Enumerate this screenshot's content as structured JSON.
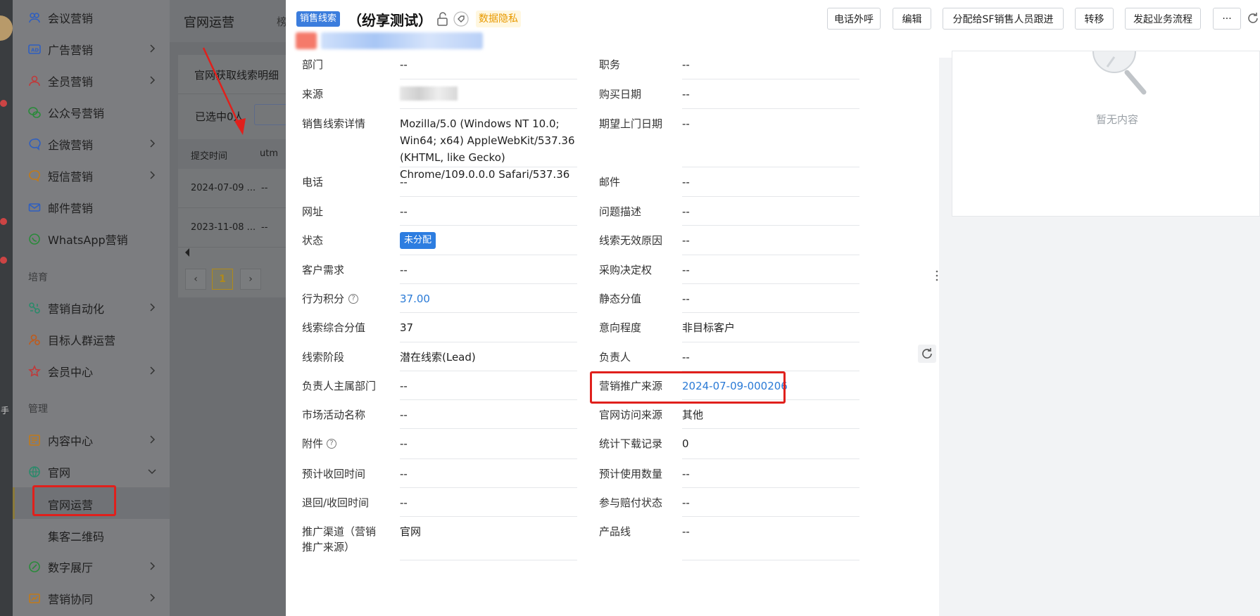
{
  "sidebar": {
    "items": [
      {
        "label": "会议营销",
        "icon": "meeting-icon"
      },
      {
        "label": "广告营销",
        "icon": "ad-icon"
      },
      {
        "label": "全员营销",
        "icon": "people-icon"
      },
      {
        "label": "公众号营销",
        "icon": "wechat-icon"
      },
      {
        "label": "企微营销",
        "icon": "wecom-icon"
      },
      {
        "label": "短信营销",
        "icon": "sms-icon"
      },
      {
        "label": "邮件营销",
        "icon": "mail-icon"
      },
      {
        "label": "WhatsApp营销",
        "icon": "whatsapp-icon"
      }
    ],
    "section_nurture": "培育",
    "nurture_items": [
      {
        "label": "营销自动化",
        "icon": "automation-icon"
      },
      {
        "label": "目标人群运营",
        "icon": "target-group-icon"
      },
      {
        "label": "会员中心",
        "icon": "member-icon"
      }
    ],
    "section_manage": "管理",
    "manage_items": [
      {
        "label": "内容中心",
        "icon": "content-icon"
      },
      {
        "label": "官网",
        "icon": "globe-icon"
      }
    ],
    "sub_items": [
      {
        "label": "官网运营"
      },
      {
        "label": "集客二维码"
      }
    ],
    "bottom_items": [
      {
        "label": "数字展厅",
        "icon": "exhibit-icon"
      },
      {
        "label": "营销协同",
        "icon": "collab-icon"
      }
    ]
  },
  "rail": {
    "char": "手"
  },
  "background": {
    "page_title": "官网运营",
    "page_title_2": "榜",
    "card_title": "官网获取线索明细",
    "selected_text": "已选中0人",
    "table_headers": [
      "提交时间",
      "utm"
    ],
    "rows": [
      {
        "time": "2024-07-09 ...",
        "val": "--"
      },
      {
        "time": "2023-11-08 ...",
        "val": "--"
      }
    ],
    "page_current": "1"
  },
  "drawer": {
    "type_tag": "销售线索",
    "title": "（纷享测试）",
    "privacy_tag": "数据隐私",
    "buttons": [
      "电话外呼",
      "编辑",
      "分配给SF销售人员跟进",
      "转移",
      "发起业务流程",
      "···"
    ],
    "left_fields": [
      {
        "label": "部门",
        "value": "--"
      },
      {
        "label": "来源",
        "value": ""
      },
      {
        "label": "销售线索详情",
        "value": "Mozilla/5.0 (Windows NT 10.0; Win64; x64) AppleWebKit/537.36 (KHTML, like Gecko) Chrome/109.0.0.0 Safari/537.36"
      },
      {
        "label": "电话",
        "value": "--"
      },
      {
        "label": "网址",
        "value": "--"
      },
      {
        "label": "状态",
        "value": "未分配"
      },
      {
        "label": "客户需求",
        "value": "--"
      },
      {
        "label": "行为积分",
        "value": "37.00"
      },
      {
        "label": "线索综合分值",
        "value": "37"
      },
      {
        "label": "线索阶段",
        "value": "潜在线索(Lead)"
      },
      {
        "label": "负责人主属部门",
        "value": "--"
      },
      {
        "label": "市场活动名称",
        "value": "--"
      },
      {
        "label": "附件",
        "value": "--"
      },
      {
        "label": "预计收回时间",
        "value": "--"
      },
      {
        "label": "退回/收回时间",
        "value": "--"
      },
      {
        "label": "推广渠道（营销推广来源）",
        "value": "官网"
      }
    ],
    "right_fields": [
      {
        "label": "职务",
        "value": "--"
      },
      {
        "label": "购买日期",
        "value": "--"
      },
      {
        "label": "期望上门日期",
        "value": "--"
      },
      {
        "label": "邮件",
        "value": "--"
      },
      {
        "label": "问题描述",
        "value": "--"
      },
      {
        "label": "线索无效原因",
        "value": "--"
      },
      {
        "label": "采购决定权",
        "value": "--"
      },
      {
        "label": "静态分值",
        "value": "--"
      },
      {
        "label": "意向程度",
        "value": "非目标客户"
      },
      {
        "label": "负责人",
        "value": "--"
      },
      {
        "label": "营销推广来源",
        "value": "2024-07-09-000206"
      },
      {
        "label": "官网访问来源",
        "value": "其他"
      },
      {
        "label": "统计下载记录",
        "value": "0"
      },
      {
        "label": "预计使用数量",
        "value": "--"
      },
      {
        "label": "参与赔付状态",
        "value": "--"
      },
      {
        "label": "产品线",
        "value": "--"
      }
    ],
    "empty_text": "暂无内容"
  },
  "colors": {
    "accent": "#2d7de0",
    "highlight": "#e0201c",
    "privacy": "#e89a00"
  }
}
